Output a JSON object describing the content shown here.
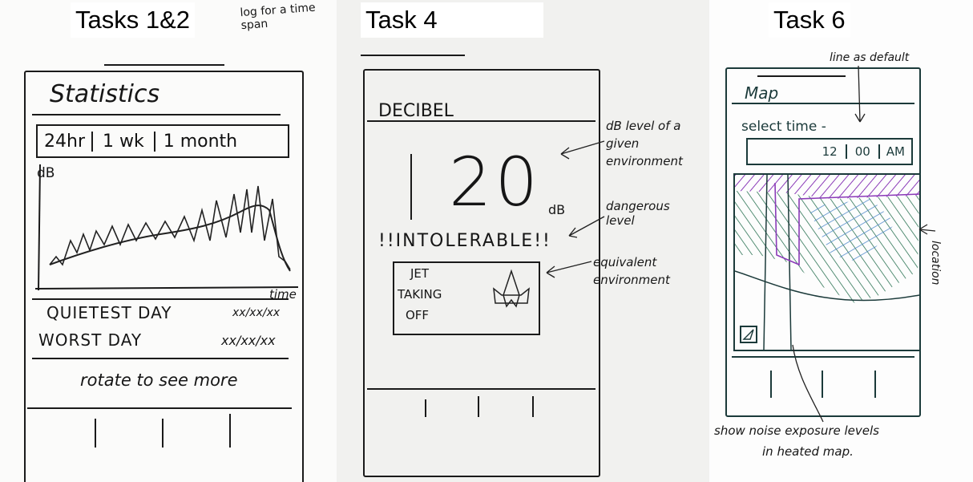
{
  "panels": [
    {
      "task_label": "Tasks 1&2",
      "screen_title": "Statistics",
      "time_tabs": [
        "24hr",
        "1 wk",
        "1 month"
      ],
      "y_axis_label": "dB",
      "x_axis_label": "time",
      "annotation": "log for a time span",
      "quietest_day": "QUIETEST DAY",
      "quietest_date": "xx/xx/xx",
      "worst_day": "WORST DAY",
      "worst_date": "xx/xx/xx",
      "footer_hint": "rotate to see more"
    },
    {
      "task_label": "Task 4",
      "screen_title": "DECIBEL",
      "level_value": "20",
      "level_unit": "dB",
      "warning": "!!INTOLERABLE!!",
      "equivalent": [
        "JET",
        "TAKING",
        "OFF"
      ],
      "annotations": [
        "dB level of a given environment",
        "dangerous level",
        "equivalent environment"
      ]
    },
    {
      "task_label": "Task 6",
      "screen_title": "Map",
      "select_time_label": "select time -",
      "time_hour": "12",
      "time_minute": "00",
      "time_ampm": "AM",
      "annotations": [
        "line as default",
        "location"
      ],
      "caption_line1": "show noise exposure levels",
      "caption_line2": "in heated map."
    }
  ]
}
